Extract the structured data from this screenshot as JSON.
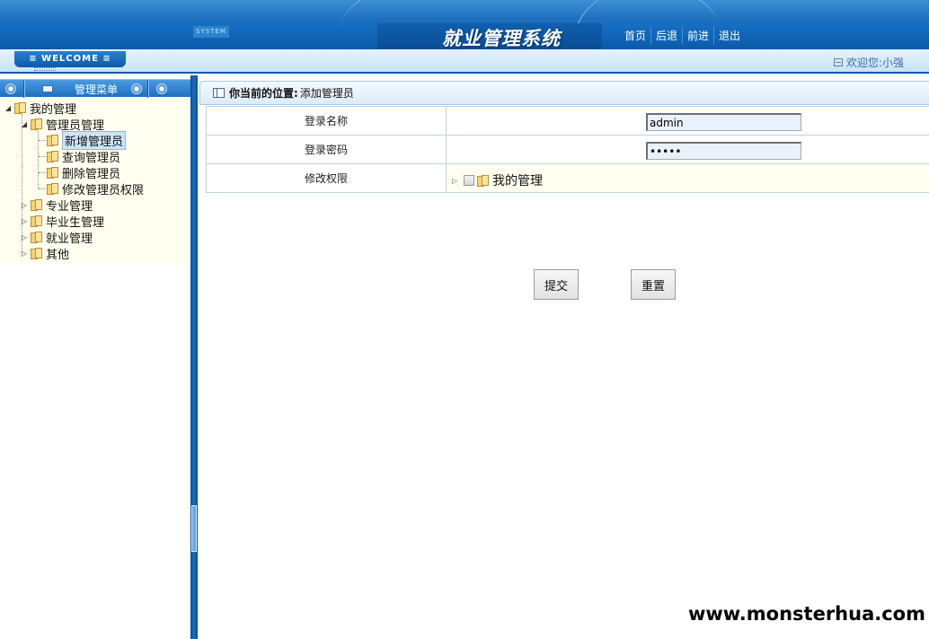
{
  "header": {
    "system_badge": "SYSTEM",
    "title": "就业管理系统",
    "nav": [
      "首页",
      "后退",
      "前进",
      "退出"
    ]
  },
  "welcome_bar": {
    "tab_label": "≡ WELCOME ≡",
    "user_text": "欢迎您:小强"
  },
  "sidebar": {
    "menu_title": "管理菜单",
    "tree": {
      "root": "我的管理",
      "admin_group": "管理员管理",
      "admin_items": [
        "新增管理员",
        "查询管理员",
        "删除管理员",
        "修改管理员权限"
      ],
      "selected_item": "新增管理员",
      "other_groups": [
        "专业管理",
        "毕业生管理",
        "就业管理",
        "其他"
      ]
    }
  },
  "main": {
    "location_label": "你当前的位置:",
    "location_value": "添加管理员",
    "form": {
      "login_name_label": "登录名称",
      "login_name_value": "admin",
      "password_label": "登录密码",
      "password_value": "admin",
      "permission_label": "修改权限",
      "permission_tree_root": "我的管理"
    },
    "submit_label": "提交",
    "reset_label": "重置"
  },
  "watermark": "www.monsterhua.com"
}
